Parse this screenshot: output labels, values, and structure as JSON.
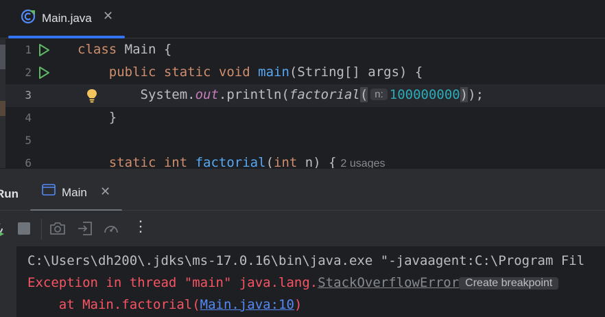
{
  "editor": {
    "tab": {
      "label": "Main.java",
      "close": "✕",
      "icon": "java-class-icon"
    },
    "lines": [
      {
        "number": "1"
      },
      {
        "number": "2"
      },
      {
        "number": "3"
      },
      {
        "number": "4"
      },
      {
        "number": "5"
      },
      {
        "number": "6"
      }
    ],
    "code": {
      "l1_kw": "class",
      "l1_rest": " Main {",
      "l2_kw": "public static void",
      "l2_fn": "main",
      "l2_rest": "(String[] args) {",
      "l3_obj": "System.",
      "l3_field": "out",
      "l3_method": ".println(",
      "l3_call": "factorial",
      "l3_paren_open": "(",
      "l3_hint": "n:",
      "l3_num": "100000000",
      "l3_paren_close": ")",
      "l3_end": ");",
      "l4": "}",
      "l6_kw": "static int",
      "l6_fn": "factorial",
      "l6_paren": "(",
      "l6_kw2": "int",
      "l6_rest": " n) {",
      "l6_usages": "2 usages"
    }
  },
  "run_panel": {
    "title": "Run",
    "tab": {
      "label": "Main",
      "close": "✕"
    },
    "toolbar": {
      "more": "⋮"
    },
    "console": {
      "line1": "C:\\Users\\dh200\\.jdks\\ms-17.0.16\\bin\\java.exe \"-javaagent:C:\\Program Fil",
      "line2_prefix": "Exception in thread \"main\" java.lang.",
      "line2_link": "StackOverflowError",
      "line2_chip": "Create breakpoint",
      "line3_prefix": "    at Main.factorial(",
      "line3_link": "Main.java:10",
      "line3_suffix": ")"
    }
  },
  "colors": {
    "background": "#1e1f22",
    "accent": "#3574f0",
    "keyword": "#cf8e6d",
    "function": "#56a8f5",
    "number": "#2aacb8",
    "error": "#f75464",
    "link": "#548af7",
    "run_green": "#5fb865"
  }
}
